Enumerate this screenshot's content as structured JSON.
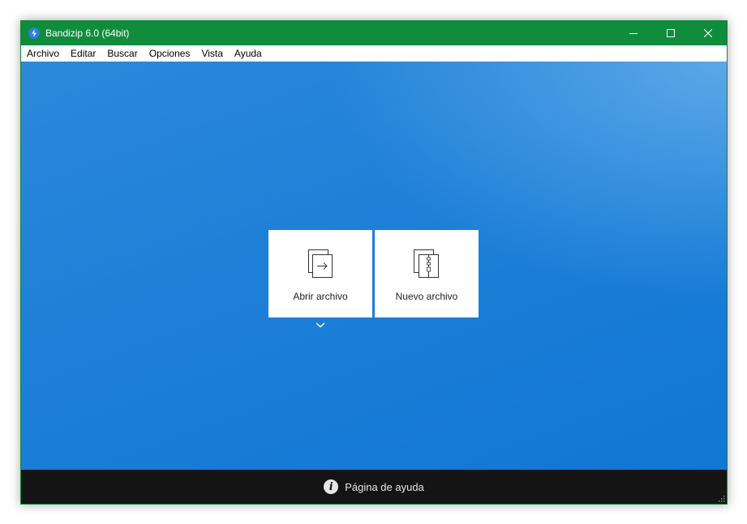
{
  "window": {
    "title": "Bandizip 6.0 (64bit)",
    "icons": {
      "app": "bandizip-logo-icon",
      "minimize": "minimize-icon",
      "maximize": "maximize-icon",
      "close": "close-icon"
    }
  },
  "menu": {
    "items": [
      {
        "label": "Archivo"
      },
      {
        "label": "Editar"
      },
      {
        "label": "Buscar"
      },
      {
        "label": "Opciones"
      },
      {
        "label": "Vista"
      },
      {
        "label": "Ayuda"
      }
    ]
  },
  "actions": {
    "open": {
      "label": "Abrir archivo",
      "icon": "open-archive-icon"
    },
    "new": {
      "label": "Nuevo archivo",
      "icon": "new-archive-icon"
    },
    "more_icon": "chevron-down-icon"
  },
  "footer": {
    "help_label": "Página de ayuda",
    "help_icon": "info-icon"
  },
  "colors": {
    "titlebar": "#108c3d",
    "main_background": "#1b7fd6",
    "footer": "#141414",
    "tile": "#ffffff"
  }
}
